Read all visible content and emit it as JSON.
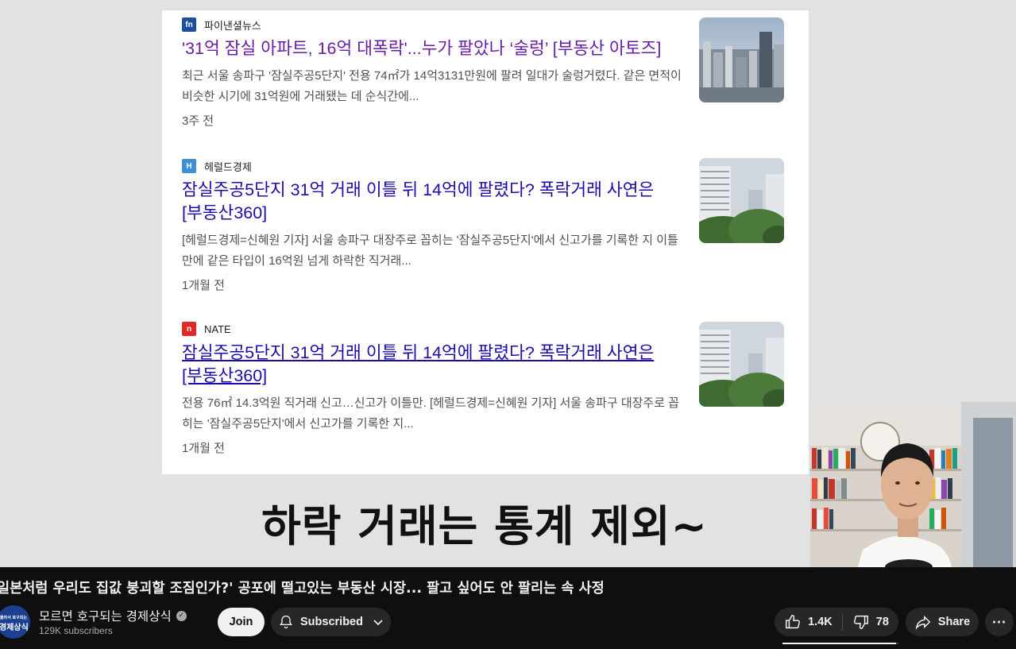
{
  "video": {
    "articles": [
      {
        "source": "파이낸셜뉴스",
        "source_logo_text": "fn",
        "source_color": "#1a4fa0",
        "headline": "'31억 잠실 아파트, 16억 대폭락'...누가 팔았나 ‘술렁’ [부동산 아토즈]",
        "snippet": "최근 서울 송파구 '잠실주공5단지' 전용 74㎡가 14억3131만원에 팔려 일대가 술렁거렸다. 같은 면적이 비슷한 시기에 31억원에 거래됐는 데 순식간에...",
        "age": "3주 전"
      },
      {
        "source": "헤럴드경제",
        "source_logo_text": "H",
        "source_color": "#3d8fd6",
        "headline": "잠실주공5단지 31억 거래 이틀 뒤 14억에 팔렸다? 폭락거래 사연은 [부동산360]",
        "snippet": "[헤럴드경제=신혜원 기자] 서울 송파구 대장주로 꼽히는 '잠실주공5단지'에서 신고가를 기록한 지 이틀 만에 같은 타입이 16억원 넘게 하락한 직거래...",
        "age": "1개월 전"
      },
      {
        "source": "NATE",
        "source_logo_text": "n",
        "source_color": "#e3282a",
        "headline": "잠실주공5단지 31억 거래 이틀 뒤 14억에 팔렸다? 폭락거래 사연은 [부동산360]",
        "snippet": "전용 76㎡ 14.3억원 직거래 신고…신고가 이틀만. [헤럴드경제=신혜원 기자] 서울 송파구 대장주로 꼽히는 '잠실주공5단지'에서 신고가를 기록한 지...",
        "age": "1개월 전"
      }
    ],
    "subtitle": "하락 거래는 통계 제외~"
  },
  "title": "일본처럼 우리도 집값 붕괴할 조짐인가?' 공포에 떨고있는 부동산 시장... 팔고 싶어도 안 팔리는 속 사정",
  "channel": {
    "avatar_line1": "몰라서 호구되는",
    "avatar_line2": "경제상식",
    "name": "모르면 호구되는 경제상식",
    "subscribers": "129K subscribers"
  },
  "actions": {
    "join": "Join",
    "subscribed": "Subscribed",
    "likes": "1.4K",
    "dislikes": "78",
    "share": "Share",
    "like_ratio": 0.98
  }
}
